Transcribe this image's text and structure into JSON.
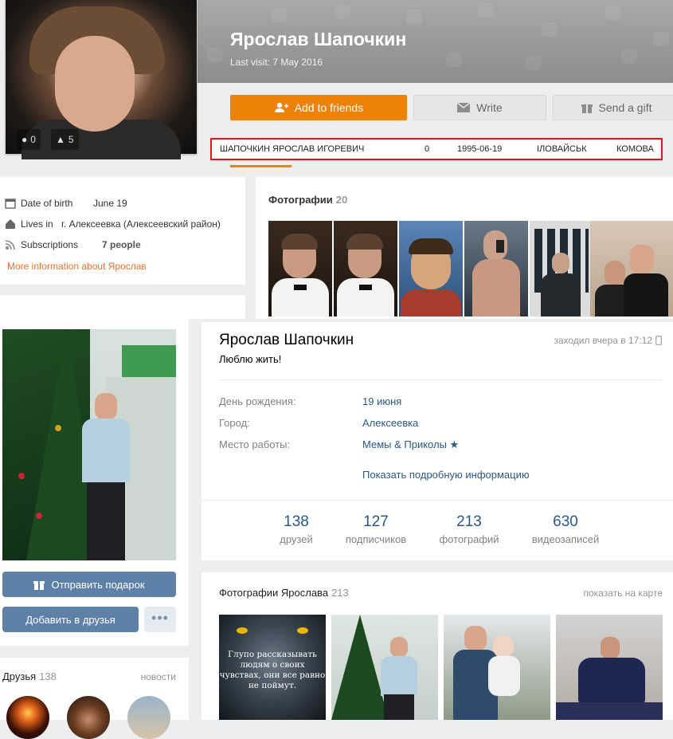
{
  "ok": {
    "name": "Ярослав Шапочкин",
    "last_visit": "Last visit: 7 May 2016",
    "counters": {
      "comments": "0",
      "likes": "5"
    },
    "buttons": {
      "add_friends": "Add to friends",
      "write": "Write",
      "send_gift": "Send a gift"
    },
    "highlight_row": [
      "ШАПОЧКИН ЯРОСЛАВ ИГОРЕВИЧ",
      "0",
      "1995-06-19",
      "ІЛОВАЙСЬК",
      "КОМОВА"
    ],
    "info": {
      "birth_label": "Date of birth",
      "birth_value": "June 19",
      "lives_label": "Lives in",
      "lives_value": "г. Алексеевка (Алексеевский район)",
      "subs_label": "Subscriptions",
      "subs_value": "7 people",
      "more_link": "More information about Ярослав"
    },
    "photos": {
      "title": "Фотографии",
      "count": "20"
    },
    "accent_color": "#ee8208",
    "highlight_color": "#e3141b"
  },
  "vk": {
    "name": "Ярослав Шапочкин",
    "status": "Люблю жить!",
    "online": "заходил вчера в 17:12",
    "info": [
      {
        "label": "День рождения:",
        "value": "19 июня"
      },
      {
        "label": "Город:",
        "value": "Алексеевка"
      },
      {
        "label": "Место работы:",
        "value": "Мемы & Приколы ★"
      }
    ],
    "show_more": "Показать подробную информацию",
    "stats": [
      {
        "num": "138",
        "label": "друзей"
      },
      {
        "num": "127",
        "label": "подписчиков"
      },
      {
        "num": "213",
        "label": "фотографий"
      },
      {
        "num": "630",
        "label": "видеозаписей"
      }
    ],
    "buttons": {
      "gift": "Отправить подарок",
      "add_friend": "Добавить в друзья",
      "more": "•••"
    },
    "friends": {
      "title": "Друзья",
      "count": "138",
      "news": "новости"
    },
    "photos": {
      "title": "Фотографии Ярослава",
      "count": "213",
      "map": "показать на карте"
    },
    "wolf_caption": "Глупо рассказывать людям о своих чувствах, они все равно не поймут.",
    "link_color": "#2a5885",
    "button_color": "#5e81a8"
  }
}
